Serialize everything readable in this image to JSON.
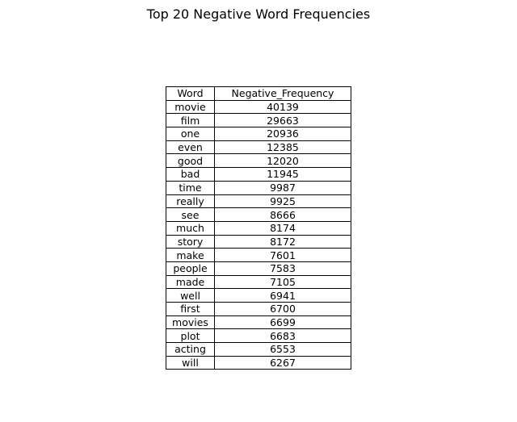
{
  "chart_data": {
    "type": "table",
    "title": "Top 20 Negative Word Frequencies",
    "columns": [
      "Word",
      "Negative_Frequency"
    ],
    "rows": [
      [
        "movie",
        "40139"
      ],
      [
        "film",
        "29663"
      ],
      [
        "one",
        "20936"
      ],
      [
        "even",
        "12385"
      ],
      [
        "good",
        "12020"
      ],
      [
        "bad",
        "11945"
      ],
      [
        "time",
        "9987"
      ],
      [
        "really",
        "9925"
      ],
      [
        "see",
        "8666"
      ],
      [
        "much",
        "8174"
      ],
      [
        "story",
        "8172"
      ],
      [
        "make",
        "7601"
      ],
      [
        "people",
        "7583"
      ],
      [
        "made",
        "7105"
      ],
      [
        "well",
        "6941"
      ],
      [
        "first",
        "6700"
      ],
      [
        "movies",
        "6699"
      ],
      [
        "plot",
        "6683"
      ],
      [
        "acting",
        "6553"
      ],
      [
        "will",
        "6267"
      ]
    ]
  }
}
